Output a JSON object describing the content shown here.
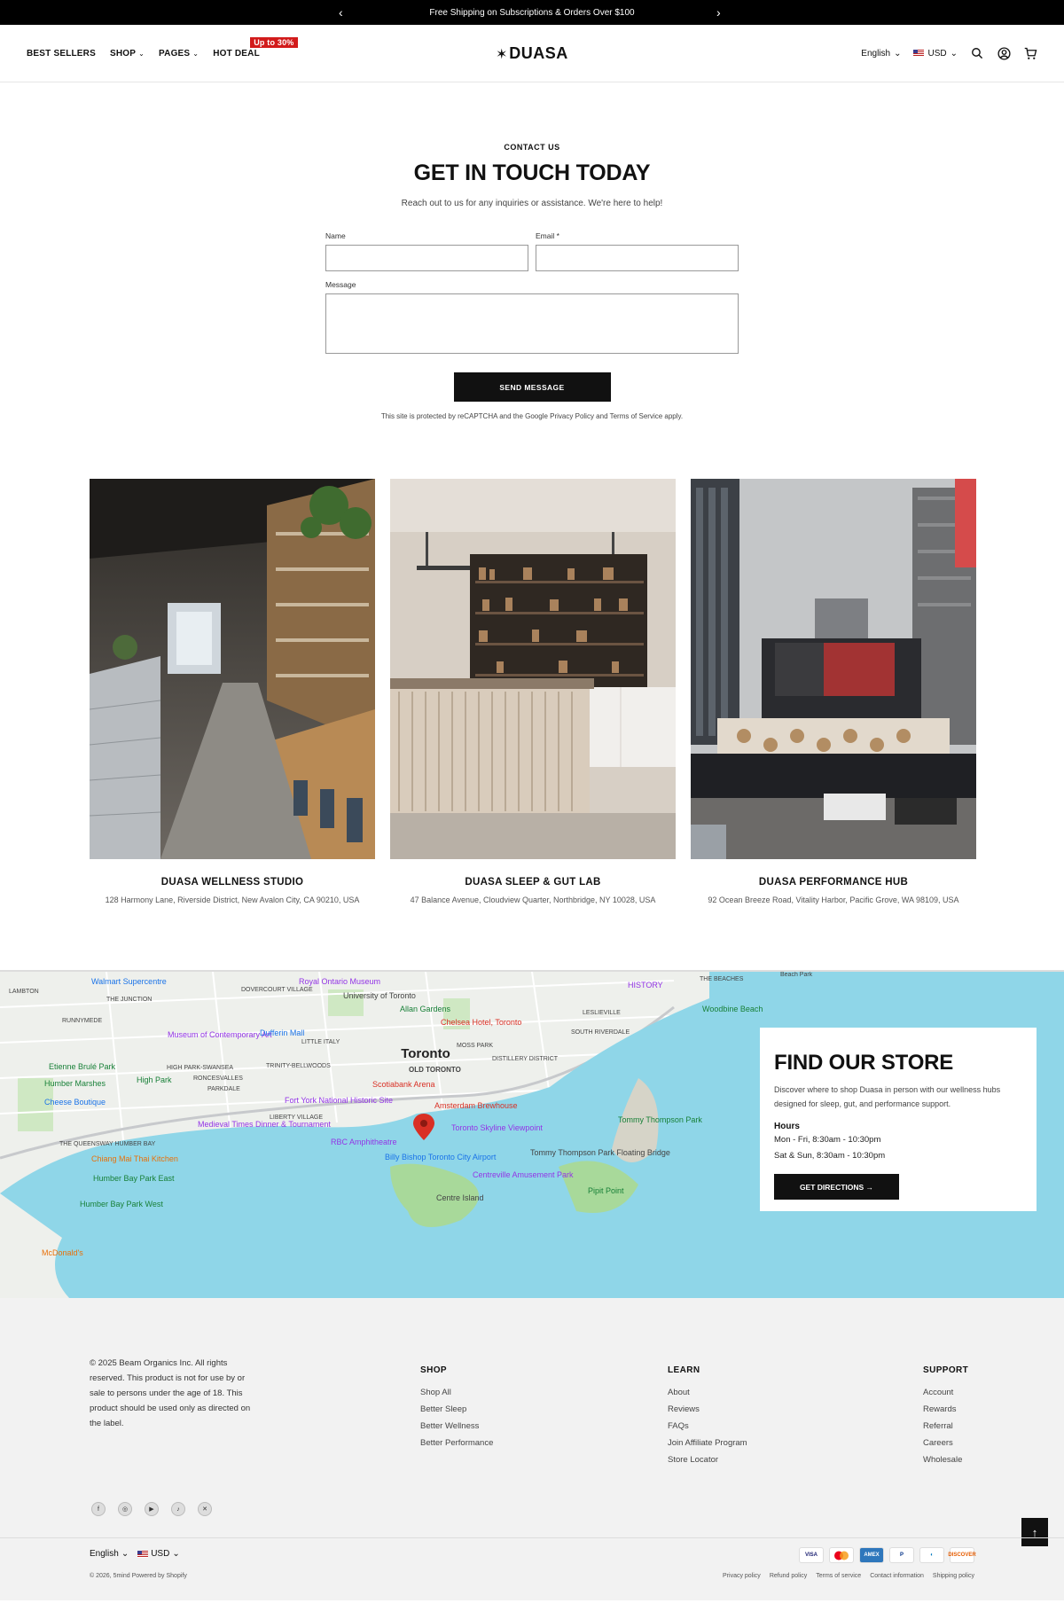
{
  "announcement": {
    "text": "Free Shipping on Subscriptions & Orders Over $100"
  },
  "header": {
    "nav": [
      {
        "label": "BEST SELLERS"
      },
      {
        "label": "SHOP"
      },
      {
        "label": "PAGES"
      },
      {
        "label": "HOT DEAL"
      }
    ],
    "hot_badge": "Up to 30%",
    "logo": "DUASA",
    "language": "English",
    "currency": "USD"
  },
  "contact": {
    "eyebrow": "CONTACT US",
    "title": "GET IN TOUCH TODAY",
    "subtitle": "Reach out to us for any inquiries or assistance. We're here to help!",
    "name_label": "Name",
    "email_label": "Email *",
    "message_label": "Message",
    "send_label": "SEND MESSAGE",
    "legal": "This site is protected by reCAPTCHA and the Google Privacy Policy and Terms of Service apply."
  },
  "stores": [
    {
      "name": "DUASA WELLNESS STUDIO",
      "address": "128 Harmony Lane, Riverside District, New Avalon City, CA 90210, USA"
    },
    {
      "name": "DUASA SLEEP & GUT LAB",
      "address": "47 Balance Avenue, Cloudview Quarter, Northbridge, NY 10028, USA"
    },
    {
      "name": "DUASA PERFORMANCE HUB",
      "address": "92 Ocean Breeze Road, Vitality Harbor, Pacific Grove, WA 98109, USA"
    }
  ],
  "map": {
    "labels": {
      "city": "Toronto",
      "walmart": "Walmart Supercentre",
      "rom": "Royal Ontario Museum",
      "the_junction": "THE JUNCTION",
      "dovercourt": "DOVERCOURT VILLAGE",
      "uoft": "University of Toronto",
      "allan": "Allan Gardens",
      "history": "HISTORY",
      "beaches": "THE BEACHES",
      "woodbine": "Woodbine Beach",
      "leslieville": "LESLIEVILLE",
      "south_riverdale": "SOUTH RIVERDALE",
      "moca": "Museum of Contemporary Art",
      "dufferin": "Dufferin Mall",
      "little_italy": "LITTLE ITALY",
      "chelsea": "Chelsea Hotel, Toronto",
      "moss_park": "MOSS PARK",
      "distillery": "DISTILLERY DISTRICT",
      "old_toronto": "OLD TORONTO",
      "trinity": "TRINITY-BELLWOODS",
      "high_park": "High Park",
      "parkdale": "PARKDALE",
      "roncesvalles": "RONCESVALLES",
      "scotiabank": "Scotiabank Arena",
      "fort_york": "Fort York National Historic Site",
      "amsterdam": "Amsterdam Brewhouse",
      "liberty": "LIBERTY VILLAGE",
      "medieval": "Medieval Times Dinner & Tournament",
      "rbc": "RBC Amphitheatre",
      "skyline": "Toronto Skyline Viewpoint",
      "tommy": "Tommy Thompson Park",
      "tommy_bridge": "Tommy Thompson Park Floating Bridge",
      "billy": "Billy Bishop Toronto City Airport",
      "centreville": "Centreville Amusement Park",
      "centre_island": "Centre Island",
      "pipit": "Pipit Point",
      "cheese": "Cheese Boutique",
      "chiang": "Chiang Mai Thai Kitchen",
      "humber_east": "Humber Bay Park East",
      "humber_west": "Humber Bay Park West",
      "mcdonalds": "McDonald's",
      "queensway": "THE QUEENSWAY HUMBER BAY",
      "runnymede": "RUNNYMEDE",
      "lambton": "LAMBTON",
      "beach_park": "Beach Park",
      "etienne": "Etienne Brulé Park",
      "humber_marshes": "Humber Marshes",
      "high_park_swansea": "HIGH PARK-SWANSEA"
    }
  },
  "find_store": {
    "title": "FIND OUR STORE",
    "description": "Discover where to shop Duasa in person with our wellness hubs designed for sleep, gut, and performance support.",
    "hours_title": "Hours",
    "hours_weekday": "Mon - Fri, 8:30am - 10:30pm",
    "hours_weekend": "Sat & Sun, 8:30am - 10:30pm",
    "directions_label": "GET DIRECTIONS →"
  },
  "footer": {
    "copyright": "© 2025 Beam Organics Inc. All rights reserved. This product is not for use by or sale to persons under the age of 18. This product should be used only as directed on the label.",
    "shop": {
      "title": "SHOP",
      "links": [
        "Shop All",
        "Better Sleep",
        "Better Wellness",
        "Better Performance"
      ]
    },
    "learn": {
      "title": "LEARN",
      "links": [
        "About",
        "Reviews",
        "FAQs",
        "Join Affiliate Program",
        "Store Locator"
      ]
    },
    "support": {
      "title": "SUPPORT",
      "links": [
        "Account",
        "Rewards",
        "Referral",
        "Careers",
        "Wholesale"
      ]
    },
    "language": "English",
    "currency": "USD",
    "powered": "© 2026, 5mind Powered by Shopify",
    "payments": [
      "VISA",
      "MC",
      "AMEX",
      "PayPal",
      "DC",
      "DISCOVER"
    ],
    "policies": [
      "Privacy policy",
      "Refund policy",
      "Terms of service",
      "Contact information",
      "Shipping policy"
    ]
  }
}
